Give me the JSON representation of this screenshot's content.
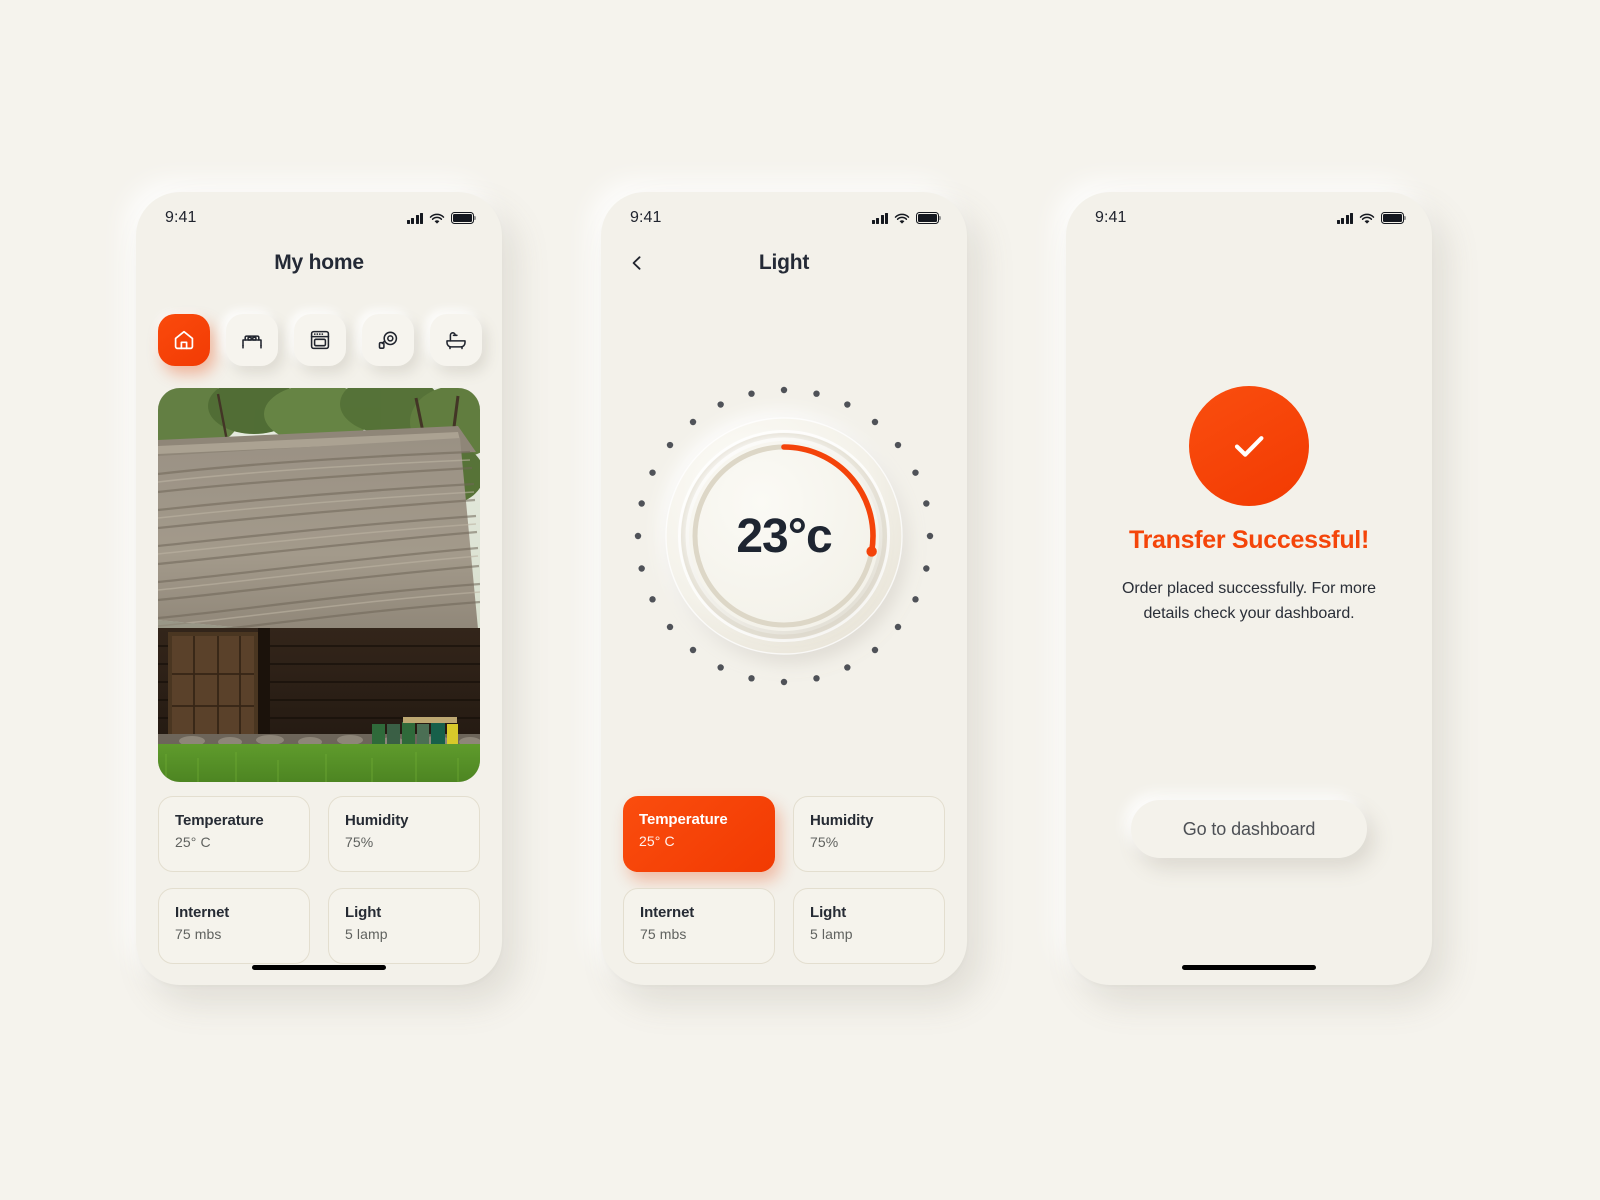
{
  "page": {
    "background_color": "#F5F3ED",
    "accent_color": "#F4430A",
    "text_color": "#242A36"
  },
  "status_bar": {
    "time": "9:41",
    "icons": [
      "cellular-signal-icon",
      "wifi-icon",
      "battery-icon"
    ]
  },
  "screens": [
    {
      "id": "home",
      "header": {
        "title": "My home",
        "has_back": false
      },
      "room_tabs": [
        {
          "name": "house",
          "icon": "house-icon",
          "active": true
        },
        {
          "name": "bedroom",
          "icon": "bed-icon",
          "active": false
        },
        {
          "name": "kitchen",
          "icon": "oven-icon",
          "active": false
        },
        {
          "name": "cooking",
          "icon": "pan-icon",
          "active": false
        },
        {
          "name": "bathroom",
          "icon": "bathtub-icon",
          "active": false
        }
      ],
      "hero_image": {
        "alt": "thatched-roof wooden cottage on green grass"
      },
      "cards": [
        {
          "title": "Temperature",
          "value": "25° C",
          "selected": false
        },
        {
          "title": "Humidity",
          "value": "75%",
          "selected": false
        },
        {
          "title": "Internet",
          "value": "75 mbs",
          "selected": false
        },
        {
          "title": "Light",
          "value": "5 lamp",
          "selected": false
        }
      ]
    },
    {
      "id": "light",
      "header": {
        "title": "Light",
        "has_back": true,
        "back_icon": "chevron-left-icon"
      },
      "dial": {
        "reading": "23°c",
        "value": 23,
        "unit": "°c",
        "arc_start_deg": 0,
        "arc_end_deg": 80,
        "arc_color": "#F4430A",
        "track_color": "#DED8C9",
        "tick_dot_count": 28,
        "tick_dot_color": "#4F5258"
      },
      "cards": [
        {
          "title": "Temperature",
          "value": "25° C",
          "selected": true
        },
        {
          "title": "Humidity",
          "value": "75%",
          "selected": false
        },
        {
          "title": "Internet",
          "value": "75 mbs",
          "selected": false
        },
        {
          "title": "Light",
          "value": "5 lamp",
          "selected": false
        }
      ]
    },
    {
      "id": "success",
      "icon": "check-circle-icon",
      "title": "Transfer Successful!",
      "subtitle": "Order placed successfully. For more details check your dashboard.",
      "button_label": "Go to dashboard"
    }
  ]
}
